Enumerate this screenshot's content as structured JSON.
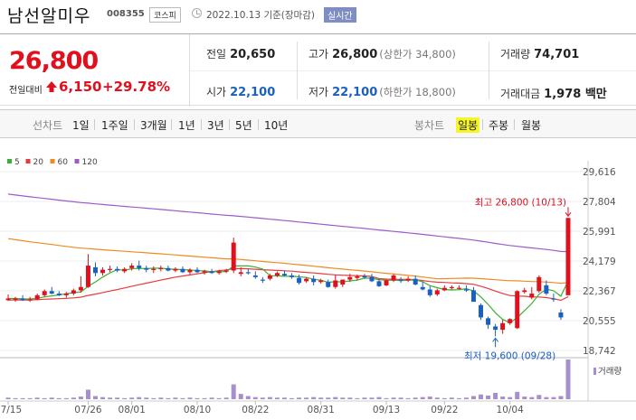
{
  "header": {
    "name": "남선알미우",
    "code": "008355",
    "market": "코스피",
    "date": "2022.10.13 기준(장마감)",
    "realtime": "실시간"
  },
  "summary": {
    "price": "26,800",
    "change_label": "전일대비",
    "change_amount": "6,150",
    "change_rate": "+29.78%",
    "prev_close_label": "전일",
    "prev_close": "20,650",
    "open_label": "시가",
    "open": "22,100",
    "high_label": "고가",
    "high": "26,800",
    "upper_limit": "(상한가 34,800)",
    "low_label": "저가",
    "low": "22,100",
    "lower_limit": "(하한가 18,800)",
    "volume_label": "거래량",
    "volume": "74,701",
    "amount_label": "거래대금",
    "amount": "1,978 백만"
  },
  "toolbar": {
    "line_label": "선차트",
    "periods": [
      "1일",
      "1주일",
      "3개월",
      "1년",
      "3년",
      "5년",
      "10년"
    ],
    "candle_label": "봉차트",
    "candle_periods": [
      "일봉",
      "주봉",
      "월봉"
    ],
    "selected_candle": "일봉"
  },
  "colors": {
    "up": "#e0101d",
    "down": "#1a5fc2",
    "ma5": "#3cb034",
    "ma20": "#e83a3a",
    "ma60": "#f08a1e",
    "ma120": "#9b5cc9"
  },
  "chart_data": {
    "type": "candlestick",
    "legend": [
      {
        "name": "5",
        "color": "#3cb034"
      },
      {
        "name": "20",
        "color": "#e83a3a"
      },
      {
        "name": "60",
        "color": "#f08a1e"
      },
      {
        "name": "120",
        "color": "#9b5cc9"
      }
    ],
    "y_ticks": [
      "29,616",
      "27,804",
      "25,991",
      "24,179",
      "22,367",
      "20,555",
      "18,742"
    ],
    "ylim": [
      18742,
      29616
    ],
    "x_ticks": [
      "07/15",
      "07/26",
      "08/01",
      "08/10",
      "08/22",
      "08/31",
      "09/13",
      "09/22",
      "10/04"
    ],
    "high_annotation": "최고 26,800 (10/13)",
    "low_annotation": "최저 19,600 (09/28)",
    "volume_label": "거래량",
    "candles": [
      [
        21800,
        22150,
        21750,
        21900
      ],
      [
        21850,
        22000,
        21700,
        21900
      ],
      [
        21900,
        22100,
        21750,
        21800
      ],
      [
        21800,
        22000,
        21700,
        21850
      ],
      [
        21850,
        22200,
        21800,
        22100
      ],
      [
        22100,
        22450,
        22000,
        22350
      ],
      [
        22350,
        22600,
        22150,
        22200
      ],
      [
        22200,
        22350,
        22050,
        22100
      ],
      [
        22100,
        22300,
        21950,
        22200
      ],
      [
        22200,
        22500,
        22100,
        22400
      ],
      [
        22400,
        23250,
        22250,
        22600
      ],
      [
        22600,
        24600,
        22550,
        23900
      ],
      [
        23800,
        24100,
        23250,
        23450
      ],
      [
        23450,
        23800,
        23300,
        23650
      ],
      [
        23650,
        23900,
        23500,
        23700
      ],
      [
        23700,
        23850,
        23500,
        23600
      ],
      [
        23550,
        23800,
        23450,
        23700
      ],
      [
        23750,
        24050,
        23600,
        23900
      ],
      [
        23900,
        24200,
        23600,
        23750
      ],
      [
        23750,
        23900,
        23500,
        23650
      ],
      [
        23650,
        23850,
        23450,
        23700
      ],
      [
        23700,
        23900,
        23550,
        23750
      ],
      [
        23750,
        23900,
        23550,
        23600
      ],
      [
        23600,
        23800,
        23500,
        23700
      ],
      [
        23700,
        23850,
        23450,
        23500
      ],
      [
        23500,
        23750,
        23350,
        23650
      ],
      [
        23650,
        23800,
        23450,
        23500
      ],
      [
        23500,
        23650,
        23350,
        23550
      ],
      [
        23550,
        23700,
        23400,
        23450
      ],
      [
        23450,
        23650,
        23350,
        23550
      ],
      [
        23550,
        23700,
        23450,
        23600
      ],
      [
        23600,
        25600,
        23450,
        25300
      ],
      [
        23400,
        23800,
        23250,
        23500
      ],
      [
        23500,
        23700,
        23350,
        23450
      ],
      [
        23300,
        23550,
        23100,
        23200
      ],
      [
        23050,
        23200,
        22850,
        23000
      ],
      [
        23100,
        23400,
        23000,
        23300
      ],
      [
        23300,
        23550,
        23200,
        23450
      ],
      [
        23400,
        23600,
        23250,
        23300
      ],
      [
        23300,
        23450,
        23100,
        23200
      ],
      [
        23150,
        23350,
        22750,
        22850
      ],
      [
        22950,
        23200,
        22850,
        23100
      ],
      [
        23100,
        23300,
        22700,
        22900
      ],
      [
        22900,
        23100,
        22800,
        23000
      ],
      [
        22900,
        23050,
        22550,
        22600
      ],
      [
        22600,
        23350,
        22500,
        23000
      ],
      [
        22750,
        23050,
        22600,
        23050
      ],
      [
        23050,
        23400,
        22900,
        23200
      ],
      [
        23150,
        23350,
        23000,
        23250
      ],
      [
        23250,
        23400,
        23100,
        23200
      ],
      [
        23200,
        23400,
        22900,
        22950
      ],
      [
        22950,
        23100,
        22600,
        22650
      ],
      [
        22700,
        23050,
        22650,
        23000
      ],
      [
        23000,
        23400,
        22900,
        23300
      ],
      [
        23050,
        23200,
        22850,
        23000
      ],
      [
        23000,
        23250,
        22900,
        23100
      ],
      [
        23100,
        23300,
        22700,
        22750
      ],
      [
        22600,
        22900,
        22400,
        22450
      ],
      [
        22450,
        22650,
        22000,
        22100
      ],
      [
        22150,
        22500,
        22050,
        22400
      ],
      [
        22400,
        22700,
        22350,
        22550
      ],
      [
        22550,
        22700,
        22450,
        22600
      ],
      [
        22550,
        22700,
        22450,
        22550
      ],
      [
        22450,
        22700,
        22300,
        22400
      ],
      [
        22400,
        22600,
        21900,
        21700
      ],
      [
        21500,
        21600,
        20600,
        20750
      ],
      [
        20700,
        20800,
        20050,
        20300
      ],
      [
        20200,
        20350,
        19600,
        20000
      ],
      [
        20000,
        20600,
        19750,
        20400
      ],
      [
        20400,
        20700,
        20300,
        20650
      ],
      [
        20100,
        22400,
        20050,
        22350
      ],
      [
        22300,
        22550,
        22200,
        22400
      ],
      [
        21950,
        22600,
        21850,
        22200
      ],
      [
        22350,
        23300,
        22250,
        23200
      ],
      [
        22700,
        23000,
        22100,
        22200
      ],
      [
        21900,
        22200,
        21700,
        21850
      ],
      [
        21050,
        21250,
        20600,
        20750
      ],
      [
        22100,
        26800,
        22100,
        26800
      ]
    ],
    "volumes": [
      3,
      2,
      2,
      2,
      3,
      2,
      3,
      2,
      2,
      3,
      5,
      18,
      6,
      4,
      3,
      3,
      2,
      3,
      4,
      3,
      2,
      3,
      2,
      3,
      2,
      3,
      2,
      2,
      3,
      2,
      3,
      28,
      10,
      6,
      4,
      3,
      4,
      3,
      3,
      2,
      3,
      3,
      4,
      3,
      3,
      4,
      3,
      3,
      2,
      3,
      3,
      4,
      2,
      3,
      3,
      2,
      3,
      4,
      5,
      3,
      2,
      3,
      2,
      3,
      6,
      9,
      7,
      12,
      5,
      4,
      14,
      5,
      4,
      8,
      4,
      4,
      6,
      75
    ]
  }
}
